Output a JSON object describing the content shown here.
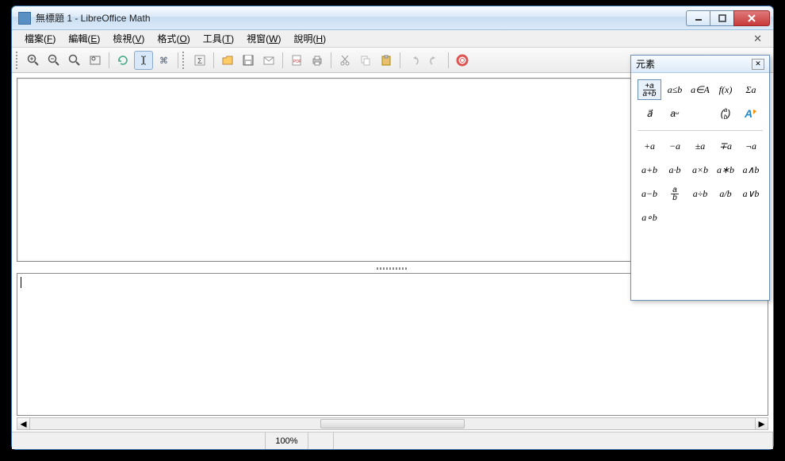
{
  "window": {
    "title": "無標題 1 - LibreOffice Math"
  },
  "menubar": {
    "items": [
      {
        "label": "檔案",
        "accel": "F"
      },
      {
        "label": "編輯",
        "accel": "E"
      },
      {
        "label": "檢視",
        "accel": "V"
      },
      {
        "label": "格式",
        "accel": "O"
      },
      {
        "label": "工具",
        "accel": "T"
      },
      {
        "label": "視窗",
        "accel": "W"
      },
      {
        "label": "說明",
        "accel": "H"
      }
    ]
  },
  "toolbar": {
    "buttons": [
      {
        "name": "zoom-in-icon"
      },
      {
        "name": "zoom-out-icon"
      },
      {
        "name": "zoom-100-icon"
      },
      {
        "name": "zoom-fit-icon"
      },
      {
        "sep": true
      },
      {
        "name": "refresh-icon"
      },
      {
        "name": "cursor-icon",
        "active": true
      },
      {
        "name": "formula-cursor-icon"
      },
      {
        "sep": true
      },
      {
        "grip": true
      },
      {
        "name": "function-icon"
      },
      {
        "sep": true
      },
      {
        "name": "open-icon"
      },
      {
        "name": "save-icon"
      },
      {
        "name": "mail-icon"
      },
      {
        "sep": true
      },
      {
        "name": "pdf-icon"
      },
      {
        "name": "print-icon"
      },
      {
        "sep": true
      },
      {
        "name": "cut-icon"
      },
      {
        "name": "copy-icon"
      },
      {
        "name": "paste-icon"
      },
      {
        "sep": true
      },
      {
        "name": "undo-icon"
      },
      {
        "name": "redo-icon"
      },
      {
        "sep": true
      },
      {
        "name": "help-icon"
      }
    ]
  },
  "elements_panel": {
    "title": "元素",
    "categories": [
      {
        "name": "unary-binary-icon",
        "label": "+a/a+b",
        "selected": true
      },
      {
        "name": "relations-icon",
        "label": "a≤b"
      },
      {
        "name": "set-ops-icon",
        "label": "a∈A"
      },
      {
        "name": "functions-icon",
        "label": "f(x)"
      },
      {
        "name": "operators-icon",
        "label": "Σa"
      },
      {
        "name": "attributes-icon",
        "label": "a⃗"
      },
      {
        "name": "others-icon",
        "label": "a␣"
      },
      {
        "name": "empty1",
        "label": ""
      },
      {
        "name": "brackets-icon",
        "label": "(ᵃ/ᵦ)"
      },
      {
        "name": "formats-icon",
        "label": "A"
      }
    ],
    "items": [
      {
        "label": "+a"
      },
      {
        "label": "−a"
      },
      {
        "label": "±a"
      },
      {
        "label": "∓a"
      },
      {
        "label": "¬a"
      },
      {
        "label": "a+b"
      },
      {
        "label": "a·b"
      },
      {
        "label": "a×b"
      },
      {
        "label": "a∗b"
      },
      {
        "label": "a∧b"
      },
      {
        "label": "a−b"
      },
      {
        "label": "a/b",
        "frac": true
      },
      {
        "label": "a÷b"
      },
      {
        "label": "a/b"
      },
      {
        "label": "a∨b"
      },
      {
        "label": "a∘b"
      }
    ]
  },
  "statusbar": {
    "zoom": "100%"
  }
}
